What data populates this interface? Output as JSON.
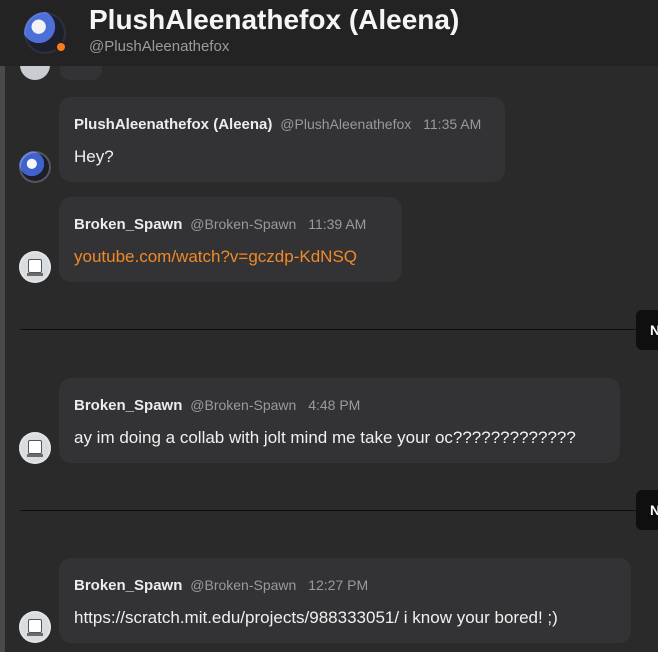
{
  "header": {
    "title": "PlushAleenathefox (Aleena)",
    "handle": "@PlushAleenathefox",
    "avatar_icon": "profile-avatar",
    "presence_color": "#ff7a1a"
  },
  "messages": [
    {
      "author": "PlushAleenathefox (Aleena)",
      "handle": "@PlushAleenathefox",
      "time": "11:35 AM",
      "text": "Hey?"
    },
    {
      "author": "Broken_Spawn",
      "handle": "@Broken-Spawn",
      "time": "11:39 AM",
      "text": "youtube.com/watch?v=gczdp-KdNSQ",
      "is_link": true,
      "link_color": "#f0892a"
    },
    {
      "author": "Broken_Spawn",
      "handle": "@Broken-Spawn",
      "time": "4:48 PM",
      "text": "ay im doing a collab with jolt mind me take your oc?????????????"
    },
    {
      "author": "Broken_Spawn",
      "handle": "@Broken-Spawn",
      "time": "12:27 PM",
      "text": "https://scratch.mit.edu/projects/988333051/ i know your bored! ;)"
    }
  ],
  "dividers": [
    {
      "tag": "N"
    },
    {
      "tag": "N"
    }
  ]
}
